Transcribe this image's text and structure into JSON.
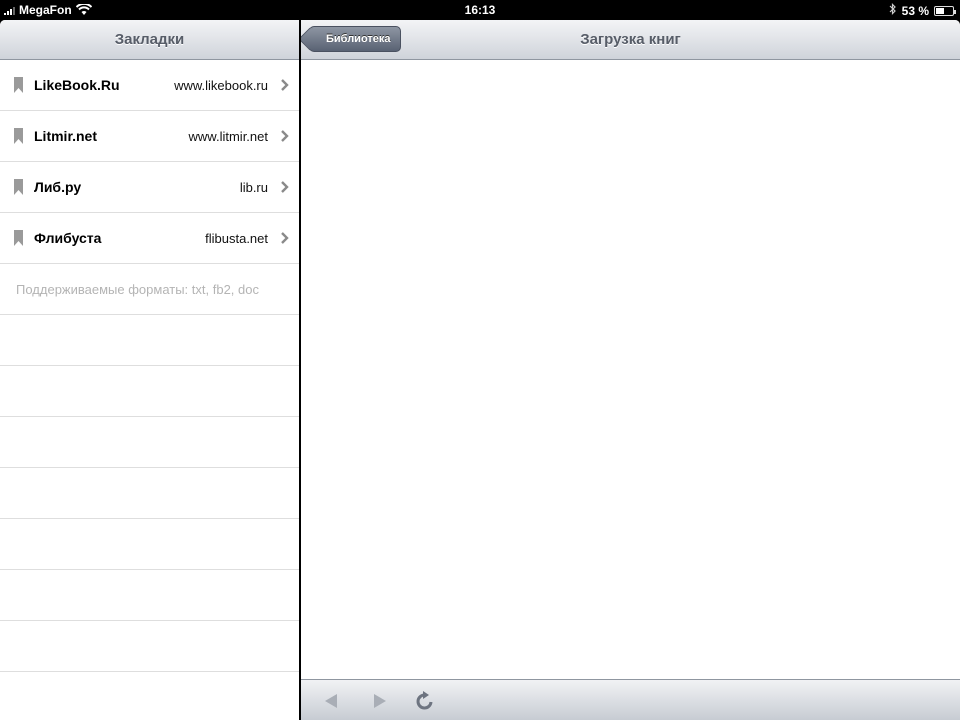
{
  "status_bar": {
    "carrier": "MegaFon",
    "time": "16:13",
    "battery_percent": "53 %",
    "battery_level": 0.53
  },
  "left_panel": {
    "title": "Закладки",
    "bookmarks": [
      {
        "title": "LikeBook.Ru",
        "url": "www.likebook.ru",
        "icon": "bookmark-icon"
      },
      {
        "title": "Litmir.net",
        "url": "www.litmir.net",
        "icon": "bookmark-icon"
      },
      {
        "title": "Либ.ру",
        "url": "lib.ru",
        "icon": "bookmark-icon"
      },
      {
        "title": "Флибуста",
        "url": "flibusta.net",
        "icon": "bookmark-icon"
      }
    ],
    "formats_note": "Поддерживаемые форматы: txt, fb2, doc"
  },
  "right_panel": {
    "back_label": "Библиотека",
    "title": "Загрузка книг",
    "toolbar": {
      "back_icon": "back-arrow-icon",
      "forward_icon": "forward-arrow-icon",
      "reload_icon": "reload-icon"
    }
  },
  "colors": {
    "header_text": "#575d68",
    "back_button": "#6b7383",
    "formats_text": "#b4b4b4"
  }
}
